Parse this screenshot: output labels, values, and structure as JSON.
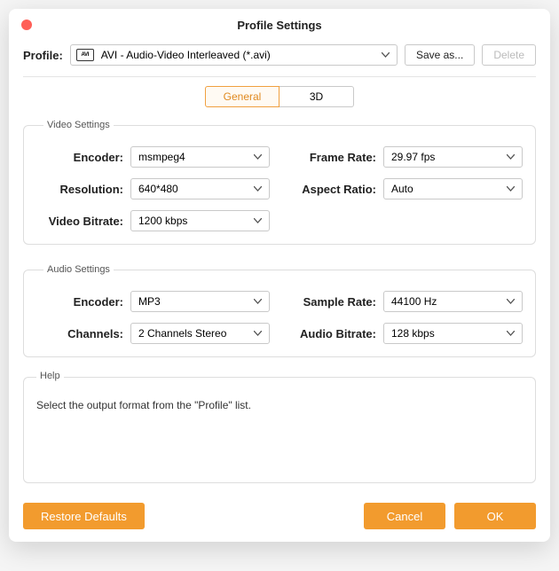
{
  "window": {
    "title": "Profile Settings"
  },
  "profile": {
    "label": "Profile:",
    "iconText": "AVI",
    "value": "AVI - Audio-Video Interleaved (*.avi)",
    "saveAs": "Save as...",
    "delete": "Delete"
  },
  "tabs": {
    "general": "General",
    "threeD": "3D"
  },
  "video": {
    "legend": "Video Settings",
    "encoderLabel": "Encoder:",
    "encoder": "msmpeg4",
    "resolutionLabel": "Resolution:",
    "resolution": "640*480",
    "bitrateLabel": "Video Bitrate:",
    "bitrate": "1200 kbps",
    "framerateLabel": "Frame Rate:",
    "framerate": "29.97 fps",
    "aspectLabel": "Aspect Ratio:",
    "aspect": "Auto"
  },
  "audio": {
    "legend": "Audio Settings",
    "encoderLabel": "Encoder:",
    "encoder": "MP3",
    "channelsLabel": "Channels:",
    "channels": "2 Channels Stereo",
    "samplerateLabel": "Sample Rate:",
    "samplerate": "44100 Hz",
    "bitrateLabel": "Audio Bitrate:",
    "bitrate": "128 kbps"
  },
  "help": {
    "legend": "Help",
    "text": "Select the output format from the \"Profile\" list."
  },
  "footer": {
    "restore": "Restore Defaults",
    "cancel": "Cancel",
    "ok": "OK"
  }
}
